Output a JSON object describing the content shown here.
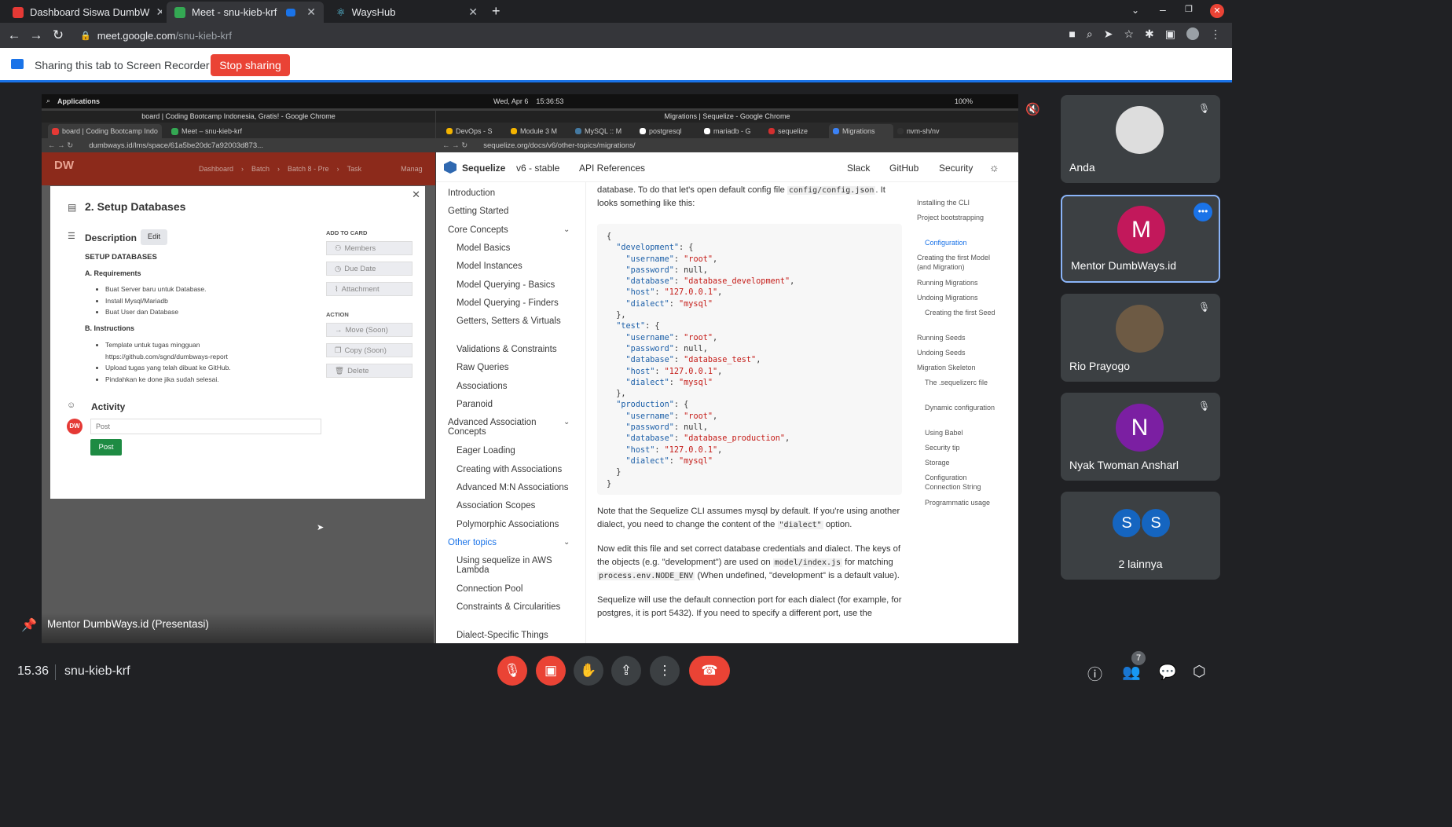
{
  "browser": {
    "tabs": [
      {
        "label": "Dashboard Siswa DumbW",
        "icon": "dumbways-icon"
      },
      {
        "label": "Meet - snu-kieb-krf",
        "icon": "meet-icon"
      },
      {
        "label": "WaysHub",
        "icon": "react-icon"
      }
    ],
    "url_domain": "meet.google.com",
    "url_path": "/snu-kieb-krf"
  },
  "sharebar": {
    "message": "Sharing this tab to Screen Recorder",
    "stop_label": "Stop sharing"
  },
  "presentation": {
    "os_bar": {
      "apps": "Applications",
      "datetime": "Wed, Apr 6    15:36:53",
      "battery": "100%"
    },
    "left_window": {
      "title": "board | Coding Bootcamp Indonesia, Gratis! - Google Chrome",
      "tabs": [
        "board | Coding Bootcamp Indo",
        "Meet – snu-kieb-krf"
      ],
      "url": "dumbways.id/lms/space/61a5be20dc7a92003d873...",
      "breadcrumb": [
        "Dashboard",
        "Batch",
        "Batch 8 - Pre",
        "Task",
        "Manag"
      ],
      "card": {
        "title": "2. Setup Databases",
        "description_label": "Description",
        "edit_label": "Edit",
        "heading": "SETUP DATABASES",
        "req_title": "A. Requirements",
        "requirements": [
          "Buat Server baru untuk Database.",
          "Install Mysql/Mariadb",
          "Buat User dan Database"
        ],
        "ins_title": "B. Instructions",
        "instructions": [
          "Template untuk tugas mingguan",
          "https://github.com/sgnd/dumbways-report",
          "Upload tugas yang telah dibuat ke GitHub.",
          "Pindahkan ke done jika sudah selesai."
        ],
        "add_to_card": "ADD TO CARD",
        "add_buttons": [
          "Members",
          "Due Date",
          "Attachment"
        ],
        "action_label": "ACTION",
        "action_buttons": [
          "Move (Soon)",
          "Copy (Soon)",
          "Delete"
        ],
        "activity_label": "Activity",
        "post_placeholder": "Post",
        "post_button": "Post"
      }
    },
    "right_window": {
      "title": "Migrations | Sequelize - Google Chrome",
      "tabs": [
        "DevOps - S",
        "Module 3 M",
        "MySQL :: M",
        "postgresql",
        "mariadb - G",
        "sequelize",
        "Migrations",
        "nvm-sh/nv"
      ],
      "url": "sequelize.org/docs/v6/other-topics/migrations/",
      "header": {
        "brand": "Sequelize",
        "version": "v6 - stable",
        "api": "API References",
        "links": [
          "Slack",
          "GitHub",
          "Security"
        ]
      },
      "sidebar": [
        {
          "label": "Introduction",
          "sub": false
        },
        {
          "label": "Getting Started",
          "sub": false
        },
        {
          "label": "Core Concepts",
          "sub": false,
          "chevron": true
        },
        {
          "label": "Model Basics",
          "sub": true
        },
        {
          "label": "Model Instances",
          "sub": true
        },
        {
          "label": "Model Querying - Basics",
          "sub": true
        },
        {
          "label": "Model Querying - Finders",
          "sub": true
        },
        {
          "label": "Getters, Setters & Virtuals",
          "sub": true
        },
        {
          "label": "Validations & Constraints",
          "sub": true
        },
        {
          "label": "Raw Queries",
          "sub": true
        },
        {
          "label": "Associations",
          "sub": true
        },
        {
          "label": "Paranoid",
          "sub": true
        },
        {
          "label": "Advanced Association Concepts",
          "sub": false,
          "chevron": true
        },
        {
          "label": "Eager Loading",
          "sub": true
        },
        {
          "label": "Creating with Associations",
          "sub": true
        },
        {
          "label": "Advanced M:N Associations",
          "sub": true
        },
        {
          "label": "Association Scopes",
          "sub": true
        },
        {
          "label": "Polymorphic Associations",
          "sub": true
        },
        {
          "label": "Other topics",
          "sub": false,
          "chevron": true,
          "active": true
        },
        {
          "label": "Using sequelize in AWS Lambda",
          "sub": true
        },
        {
          "label": "Connection Pool",
          "sub": true
        },
        {
          "label": "Constraints & Circularities",
          "sub": true
        },
        {
          "label": "Dialect-Specific Things",
          "sub": true
        }
      ],
      "intro": "database. To do that let's open default config file",
      "intro_code": "config/config.json",
      "intro_end": ". It looks something like this:",
      "para1a": "Note that the Sequelize CLI assumes mysql by default. If you're using another dialect, you need to change the content of the",
      "para1code": "\"dialect\"",
      "para1b": "option.",
      "para2a": "Now edit this file and set correct database credentials and dialect. The keys of the objects (e.g. \"development\") are used on",
      "para2code1": "model/index.js",
      "para2b": "for matching",
      "para2code2": "process.env.NODE_ENV",
      "para2c": "(When undefined, \"development\" is a default value).",
      "para3": "Sequelize will use the default connection port for each dialect (for example, for postgres, it is port 5432). If you need to specify a different port, use the",
      "toc": [
        "Installing the CLI",
        "Project bootstrapping",
        "Configuration",
        "Creating the first Model (and Migration)",
        "Running Migrations",
        "Undoing Migrations",
        "Creating the first Seed",
        "Running Seeds",
        "Undoing Seeds",
        "Migration Skeleton",
        "The .sequelizerc file",
        "Dynamic configuration",
        "Using Babel",
        "Security tip",
        "Storage",
        "Configuration Connection String",
        "Programmatic usage"
      ]
    },
    "presenter_label": "Mentor DumbWays.id (Presentasi)"
  },
  "participants": [
    {
      "name": "Anda",
      "initial": ""
    },
    {
      "name": "Mentor DumbWays.id",
      "initial": "M",
      "color": "#c2185b"
    },
    {
      "name": "Rio Prayogo",
      "initial": ""
    },
    {
      "name": "Nyak Twoman Ansharl",
      "initial": "N",
      "color": "#7b1fa2"
    },
    {
      "name": "2 lainnya",
      "initial": "S",
      "color": "#1565c0"
    }
  ],
  "bottom": {
    "time": "15.36",
    "meeting_code": "snu-kieb-krf",
    "people_count": "7"
  },
  "colors": {
    "accent": "#1a73e8",
    "danger": "#ea4335",
    "tile": "#3c4043"
  }
}
